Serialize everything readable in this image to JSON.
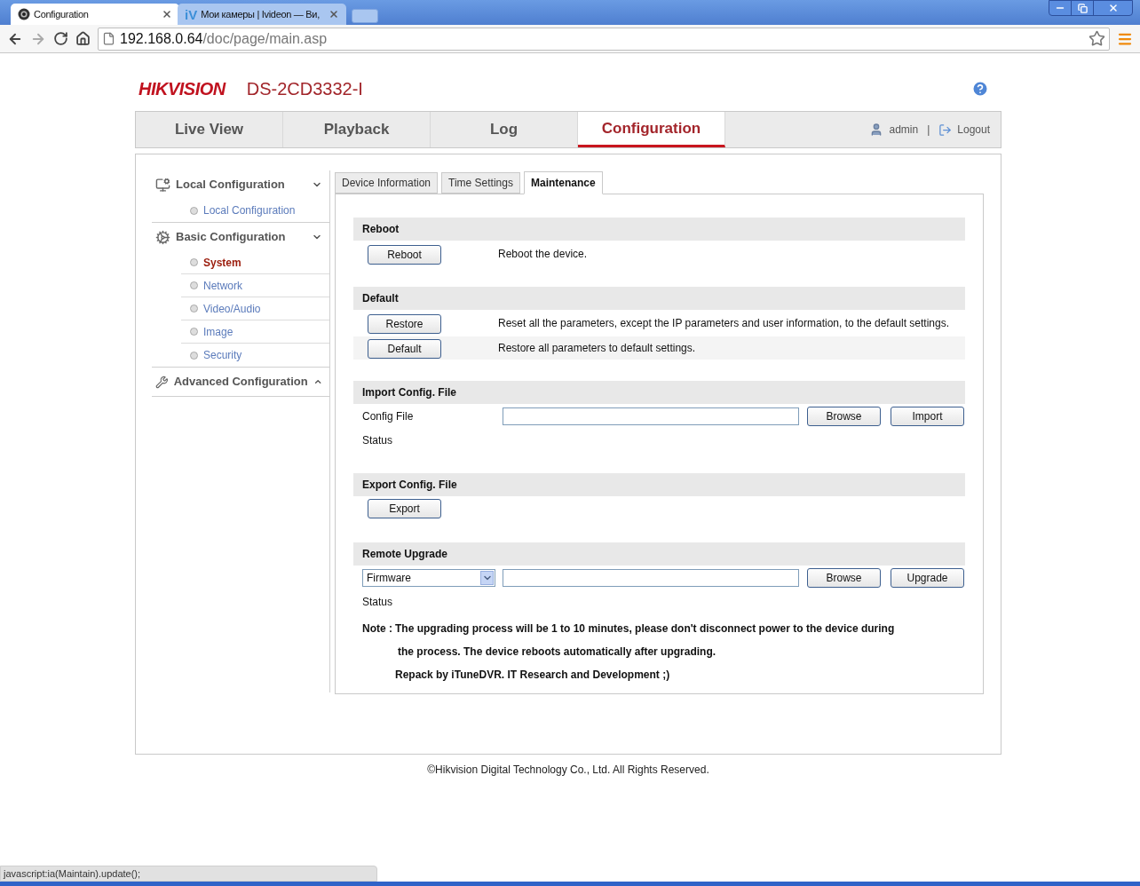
{
  "browser": {
    "tabs": [
      {
        "title": "Configuration",
        "selected": true
      },
      {
        "title": "Мои камеры | Ivideon — Ви,",
        "favicon_text": "iV",
        "selected": false
      }
    ],
    "address": {
      "host": "192.168.0.64",
      "path": "/doc/page/main.asp"
    }
  },
  "header": {
    "logo": "HIKVISION",
    "model": "DS-2CD3332-I"
  },
  "nav": {
    "tabs": [
      {
        "label": "Live View",
        "selected": false
      },
      {
        "label": "Playback",
        "selected": false
      },
      {
        "label": "Log",
        "selected": false
      },
      {
        "label": "Configuration",
        "selected": true
      }
    ],
    "user": "admin",
    "separator": "|",
    "logout": "Logout"
  },
  "sidebar": {
    "groups": [
      {
        "label": "Local Configuration",
        "expanded": true,
        "children": [
          {
            "label": "Local Configuration",
            "selected": false
          }
        ]
      },
      {
        "label": "Basic Configuration",
        "expanded": true,
        "children": [
          {
            "label": "System",
            "selected": true
          },
          {
            "label": "Network",
            "selected": false
          },
          {
            "label": "Video/Audio",
            "selected": false
          },
          {
            "label": "Image",
            "selected": false
          },
          {
            "label": "Security",
            "selected": false
          }
        ]
      },
      {
        "label": "Advanced Configuration",
        "expanded": false
      }
    ]
  },
  "subtabs": [
    {
      "label": "Device Information",
      "selected": false
    },
    {
      "label": "Time Settings",
      "selected": false
    },
    {
      "label": "Maintenance",
      "selected": true
    }
  ],
  "sections": [
    {
      "title": "Reboot",
      "rows": [
        {
          "kind": "action",
          "button": "Reboot",
          "text": "Reboot the device."
        }
      ]
    },
    {
      "title": "Default",
      "rows": [
        {
          "kind": "action",
          "button": "Restore",
          "text": "Reset all the parameters, except the IP parameters and user information, to the default settings."
        },
        {
          "kind": "action",
          "button": "Default",
          "text": "Restore all parameters to default settings."
        }
      ]
    },
    {
      "title": "Import Config. File",
      "rows": [
        {
          "kind": "file",
          "label": "Config File",
          "buttons": [
            "Browse",
            "Import"
          ]
        },
        {
          "kind": "status",
          "label": "Status"
        }
      ]
    },
    {
      "title": "Export Config. File",
      "rows": [
        {
          "kind": "button",
          "button": "Export"
        }
      ]
    },
    {
      "title": "Remote Upgrade",
      "rows": [
        {
          "kind": "select_file",
          "select": "Firmware",
          "buttons": [
            "Browse",
            "Upgrade"
          ]
        },
        {
          "kind": "status",
          "label": "Status"
        },
        {
          "kind": "note",
          "label": "Note :",
          "lines": [
            "The upgrading process will be 1 to 10 minutes, please don't disconnect power to the device during",
            "the process. The device reboots automatically after upgrading.",
            "Repack by iTuneDVR. IT Research and Development ;)"
          ]
        }
      ]
    }
  ],
  "footer": "©Hikvision Digital Technology Co., Ltd. All Rights Reserved.",
  "status_bar": "javascript:ia(Maintain).update();"
}
